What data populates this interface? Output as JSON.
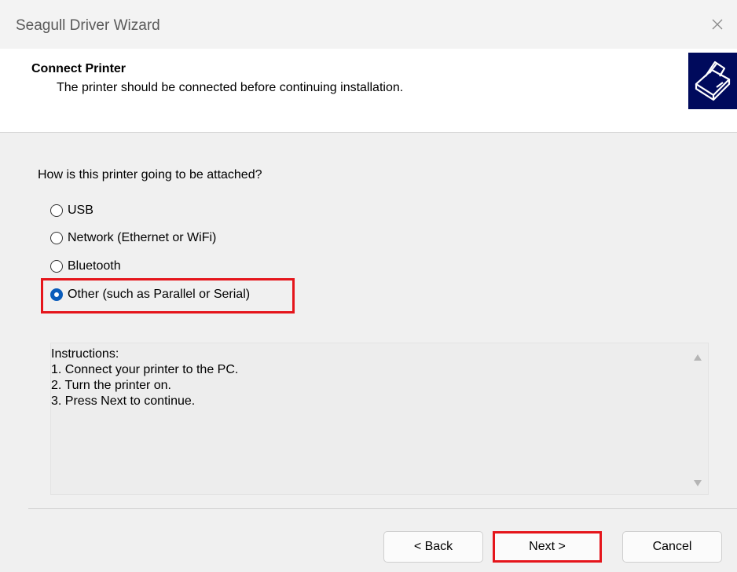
{
  "window": {
    "title": "Seagull Driver Wizard",
    "close_icon": "close-icon"
  },
  "header": {
    "title": "Connect Printer",
    "subtitle": "The printer should be connected before continuing installation.",
    "logo_icon": "printer-logo-icon"
  },
  "form": {
    "question": "How is this printer going to be attached?",
    "options": [
      {
        "label": "USB",
        "selected": false
      },
      {
        "label": "Network (Ethernet or WiFi)",
        "selected": false
      },
      {
        "label": "Bluetooth",
        "selected": false
      },
      {
        "label": "Other (such as Parallel or Serial)",
        "selected": true
      }
    ]
  },
  "instructions": {
    "text": "Instructions:\n1. Connect your printer to the PC.\n2. Turn the printer on.\n3. Press Next to continue."
  },
  "buttons": {
    "back": "< Back",
    "next": "Next >",
    "cancel": "Cancel"
  },
  "colors": {
    "accent": "#0a5cbb",
    "highlight": "#e5151b",
    "logo_bg": "#000a5c"
  }
}
